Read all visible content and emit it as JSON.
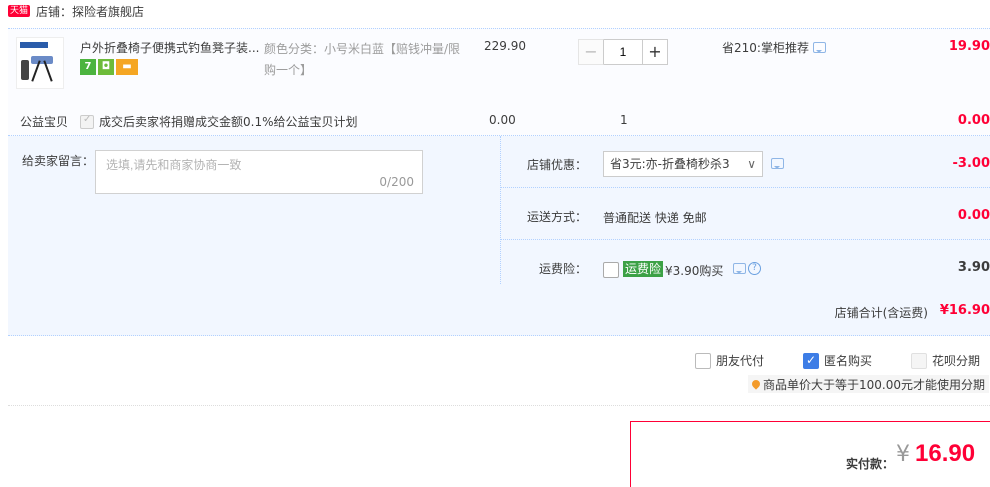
{
  "shop": {
    "badge": "天猫",
    "name": "店铺：探险者旗舰店"
  },
  "item": {
    "title": "户外折叠椅子便携式钓鱼凳子装...",
    "sku": "颜色分类：小号米白蓝【赔钱冲量/限购一个】",
    "unit_price": "229.90",
    "quantity": "1",
    "minus": "−",
    "plus": "+",
    "saving": "省210:掌柜推荐",
    "subtotal": "19.90",
    "service_icons": [
      "seven-day-return-icon",
      "shield-icon",
      "card-icon"
    ]
  },
  "charity": {
    "label": "公益宝贝",
    "text": "成交后卖家将捐赠成交金额0.1%给公益宝贝计划",
    "price": "0.00",
    "qty": "1",
    "subtotal": "0.00"
  },
  "message": {
    "label": "给卖家留言：",
    "placeholder": "选填,请先和商家协商一致",
    "counter": "0/200"
  },
  "coupon": {
    "label": "店铺优惠：",
    "selected": "省3元:亦-折叠椅秒杀3",
    "value": "-3.00"
  },
  "shipping": {
    "label": "运送方式：",
    "method": "普通配送 快递 免邮",
    "value": "0.00"
  },
  "insurance": {
    "label": "运费险：",
    "badge": "运费险",
    "text": "¥3.90购买",
    "value": "3.90"
  },
  "total": {
    "label": "店铺合计(含运费)",
    "value": "¥16.90"
  },
  "options": {
    "friend_pay": "朋友代付",
    "anonymous": "匿名购买",
    "huabei": "花呗分期",
    "huabei_note": "商品单价大于等于100.00元才能使用分期"
  },
  "payment": {
    "label": "实付款：",
    "yen": "¥",
    "amount": "16.90"
  },
  "colors": {
    "accent": "#ff0036",
    "link": "#3d7de6",
    "panel": "#f2f7ff"
  }
}
